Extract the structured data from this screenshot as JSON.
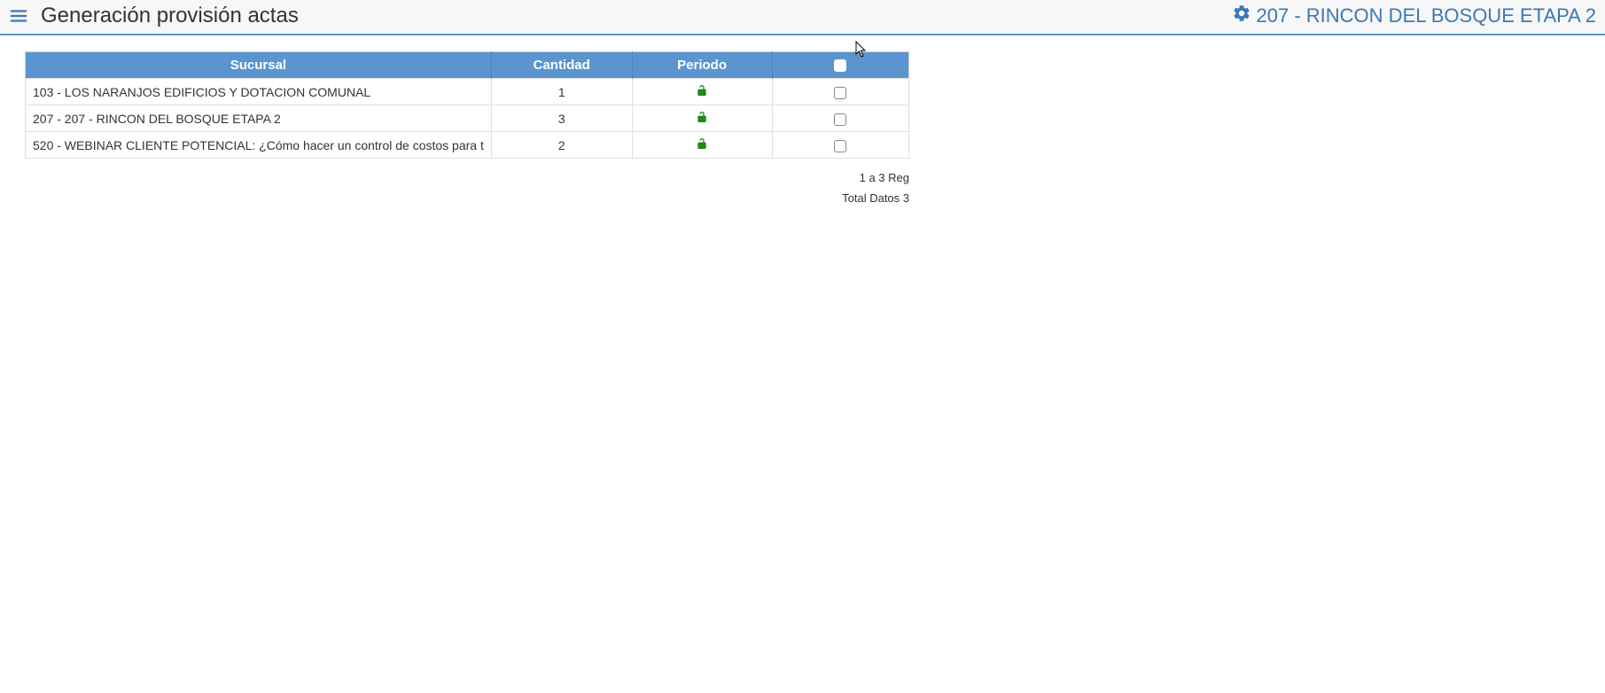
{
  "header": {
    "title": "Generación provisión actas",
    "context_label": "207 - RINCON DEL BOSQUE ETAPA 2"
  },
  "table": {
    "headers": {
      "sucursal": "Sucursal",
      "cantidad": "Cantidad",
      "periodo": "Periodo"
    },
    "rows": [
      {
        "sucursal": "103 - LOS NARANJOS EDIFICIOS Y DOTACION COMUNAL",
        "cantidad": "1"
      },
      {
        "sucursal": "207 - 207 - RINCON DEL BOSQUE ETAPA 2",
        "cantidad": "3"
      },
      {
        "sucursal": "520 - WEBINAR CLIENTE POTENCIAL: ¿Cómo hacer un control de costos para t",
        "cantidad": "2"
      }
    ]
  },
  "footer": {
    "range": "1 a 3 Reg",
    "total": "Total Datos 3"
  }
}
